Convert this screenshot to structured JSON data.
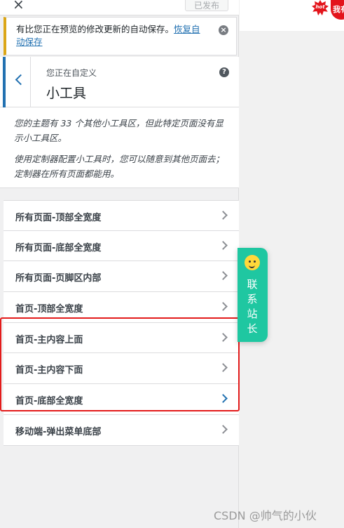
{
  "topbar": {
    "close_label": "×",
    "publish_label": "已发布"
  },
  "notice": {
    "text": "有比您正在预览的修改更新的自动保存。",
    "link": "恢复自动保存",
    "close_icon": "×"
  },
  "section": {
    "action_label": "您正在自定义",
    "title": "小工具",
    "help_icon": "?"
  },
  "description": {
    "line1": "您的主题有 33 个其他小工具区，但此特定页面没有显示小工具区。",
    "line2": "使用定制器配置小工具时，您可以随意到其他页面去；定制器在所有页面都能用。"
  },
  "widgets": [
    {
      "label": "所有页面-顶部全宽度"
    },
    {
      "label": "所有页面-底部全宽度"
    },
    {
      "label": "所有页面-页脚区内部"
    },
    {
      "label": "首页-顶部全宽度"
    },
    {
      "label": "首页-主内容上面"
    },
    {
      "label": "首页-主内容下面"
    },
    {
      "label": "首页-底部全宽度"
    },
    {
      "label": "移动端-弹出菜单底部"
    }
  ],
  "float_contact": {
    "text": "联系站长"
  },
  "preview": {
    "hot_badge": "hot",
    "badge_text": "我有"
  },
  "watermark": "CSDN @帅气的小伙",
  "colors": {
    "accent": "#2271b1",
    "highlight": "#e31b1b",
    "float": "#1fc7a1",
    "notice_border": "#dba617"
  }
}
